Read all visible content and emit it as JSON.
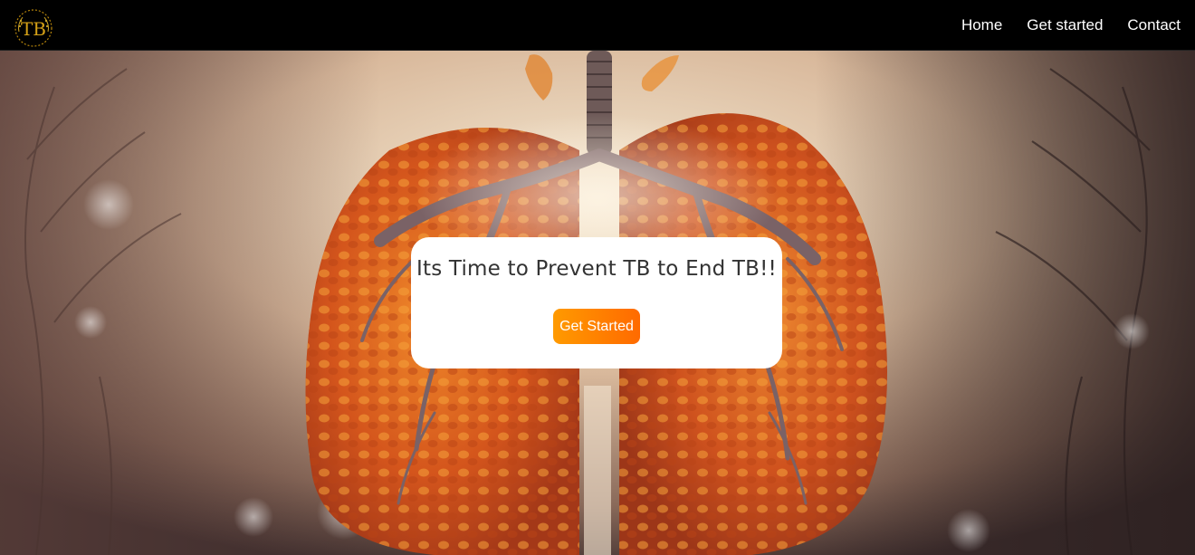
{
  "brand": {
    "logo_text": "TB",
    "logo_color": "#d4a017"
  },
  "nav": {
    "items": [
      {
        "label": "Home"
      },
      {
        "label": "Get started"
      },
      {
        "label": "Contact"
      }
    ]
  },
  "hero": {
    "title": "Its Time to Prevent TB to End TB!!",
    "button_label": "Get Started",
    "button_gradient": [
      "#ff9a00",
      "#ff6a00"
    ]
  }
}
